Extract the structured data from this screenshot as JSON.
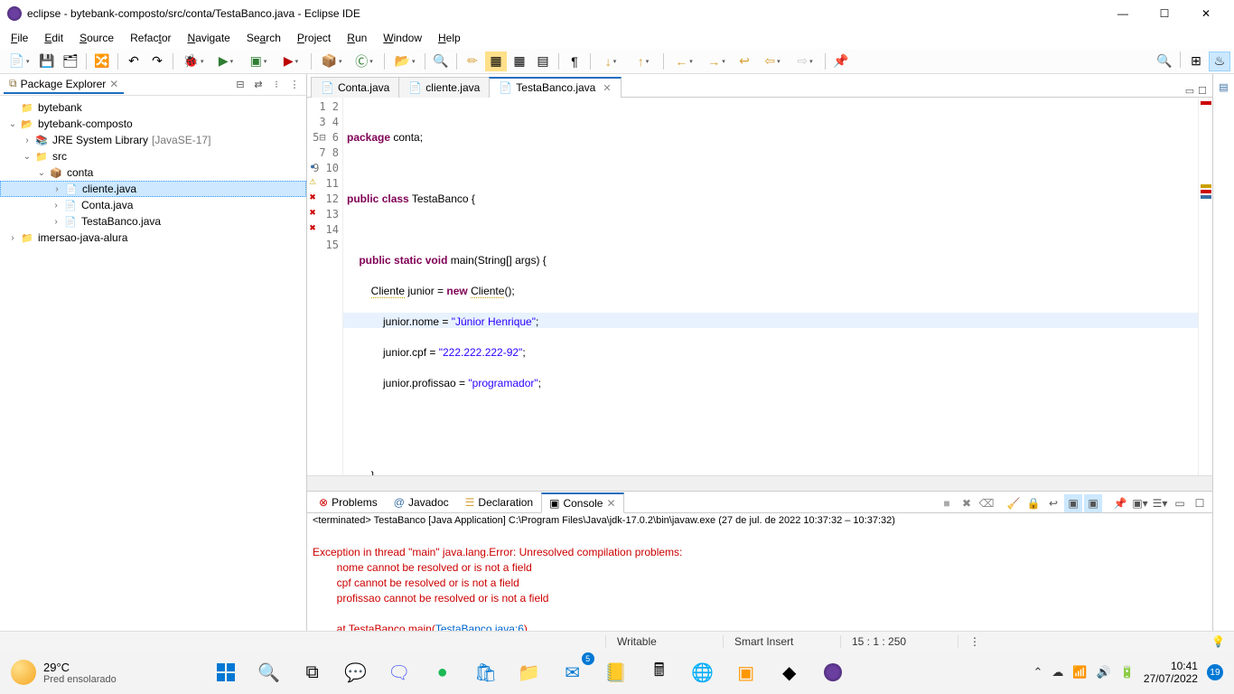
{
  "titlebar": {
    "title": "eclipse - bytebank-composto/src/conta/TestaBanco.java - Eclipse IDE"
  },
  "menubar": [
    "File",
    "Edit",
    "Source",
    "Refactor",
    "Navigate",
    "Search",
    "Project",
    "Run",
    "Window",
    "Help"
  ],
  "explorer": {
    "title": "Package Explorer",
    "tree": {
      "bytebank": "bytebank",
      "bytebank_composto": "bytebank-composto",
      "jre": "JRE System Library",
      "jre_decor": "[JavaSE-17]",
      "src": "src",
      "conta": "conta",
      "cliente_java": "cliente.java",
      "conta_java": "Conta.java",
      "testa_java": "TestaBanco.java",
      "imersao": "imersao-java-alura"
    }
  },
  "editor": {
    "tabs": [
      {
        "label": "Conta.java",
        "active": false
      },
      {
        "label": "cliente.java",
        "active": false
      },
      {
        "label": "TestaBanco.java",
        "active": true
      }
    ],
    "code_lines": 15,
    "code": {
      "l1_kw": "package",
      "l1_rest": " conta;",
      "l3_kw1": "public",
      "l3_kw2": "class",
      "l3_rest": " TestaBanco {",
      "l5_kw1": "public",
      "l5_kw2": "static",
      "l5_kw3": "void",
      "l5_rest": " main(String[] args) {",
      "l6_warn1": "Cliente",
      "l6_mid": " junior = ",
      "l6_kw": "new",
      "l6_warn2": "Cliente",
      "l6_end": "();",
      "l7_a": "            junior.nome = ",
      "l7_str": "\"Júnior Henrique\"",
      "l7_b": ";",
      "l8_a": "            junior.cpf = ",
      "l8_str": "\"222.222.222-92\"",
      "l8_b": ";",
      "l9_a": "            junior.profissao = ",
      "l9_str": "\"programador\"",
      "l9_b": ";",
      "l12": "        }",
      "l14": "}"
    }
  },
  "bottom": {
    "tabs": {
      "problems": "Problems",
      "javadoc": "Javadoc",
      "declaration": "Declaration",
      "console": "Console"
    },
    "launch_desc": "<terminated> TestaBanco [Java Application] C:\\Program Files\\Java\\jdk-17.0.2\\bin\\javaw.exe (27 de jul. de 2022 10:37:32 – 10:37:32)",
    "console_lines": {
      "l1": "Exception in thread \"main\" java.lang.Error: Unresolved compilation problems: ",
      "l2": "        nome cannot be resolved or is not a field",
      "l3": "        cpf cannot be resolved or is not a field",
      "l4": "        profissao cannot be resolved or is not a field",
      "l5_pre": "        at TestaBanco.main(",
      "l5_link": "TestaBanco.java:6",
      "l5_post": ")"
    }
  },
  "statusbar": {
    "writable": "Writable",
    "insert": "Smart Insert",
    "pos": "15 : 1 : 250"
  },
  "taskbar": {
    "temp": "29°C",
    "weather": "Pred ensolarado",
    "mail_badge": "5",
    "time": "10:41",
    "date": "27/07/2022",
    "notif": "19"
  }
}
